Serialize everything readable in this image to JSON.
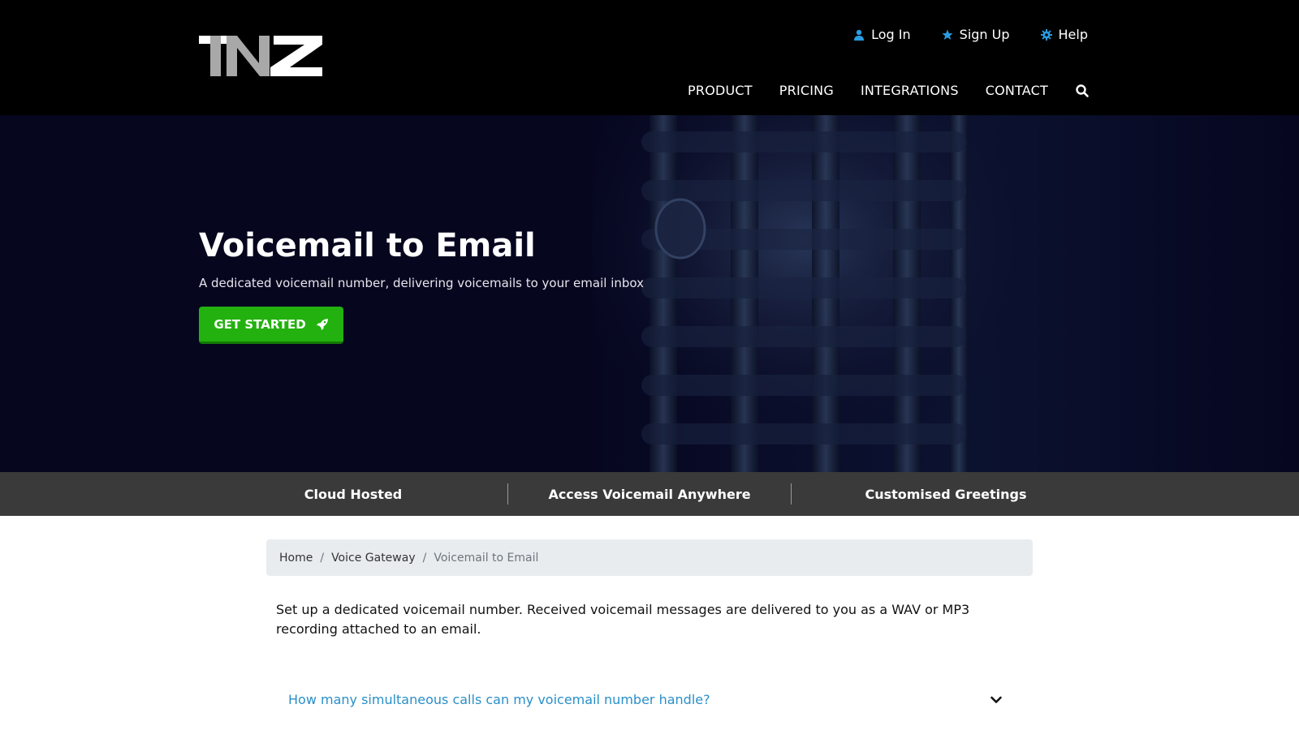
{
  "header": {
    "logo_text": "TNZ",
    "util_links": [
      {
        "label": "Log In",
        "icon": "user-icon"
      },
      {
        "label": "Sign Up",
        "icon": "star-icon"
      },
      {
        "label": "Help",
        "icon": "gear-icon"
      }
    ],
    "nav": [
      "PRODUCT",
      "PRICING",
      "INTEGRATIONS",
      "CONTACT"
    ],
    "search_icon": "search-icon"
  },
  "hero": {
    "title": "Voicemail to Email",
    "subtitle": "A dedicated voicemail number, delivering voicemails to your email inbox",
    "cta_label": "GET STARTED",
    "cta_icon": "rocket-icon"
  },
  "features": [
    "Cloud Hosted",
    "Access Voicemail Anywhere",
    "Customised Greetings"
  ],
  "breadcrumb": {
    "items": [
      "Home",
      "Voice Gateway"
    ],
    "separator": "/",
    "current": "Voicemail to Email"
  },
  "intro": "Set up a dedicated voicemail number. Received voicemail messages are delivered to you as a WAV or MP3 recording attached to an email.",
  "faq": [
    {
      "question": "How many simultaneous calls can my voicemail number handle?",
      "icon": "chevron-down-icon"
    }
  ],
  "colors": {
    "header_bg": "#000000",
    "hero_bg": "#06061f",
    "cta": "#23b10f",
    "feature_bar": "#3a3a3a",
    "link": "#2a8fc8",
    "icon_accent": "#2a9be0"
  }
}
